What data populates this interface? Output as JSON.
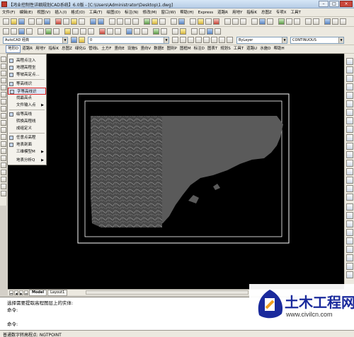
{
  "window": {
    "title": "【鸿业控制性详细规划CAD系统】6.0版 - [C:\\Users\\Administrator\\Desktop\\1.dwg]",
    "minimize_symbol": "–",
    "maximize_symbol": "□",
    "close_symbol": "×"
  },
  "menubar": {
    "items": [
      "文件(F)",
      "编辑(E)",
      "视图(V)",
      "插入(I)",
      "格式(O)",
      "工具(T)",
      "绘图(D)",
      "标注(N)",
      "修改(M)",
      "窗口(W)",
      "帮助(H)",
      "Express",
      "道路R",
      "用地Y",
      "指标K",
      "总图Z",
      "专项X",
      "工具T"
    ]
  },
  "toolbar3": {
    "workspace_combo": "AutoCAD 经典",
    "layer_combo": "0",
    "color_combo": "ByLayer",
    "linetype_combo": "CONTINUOUS"
  },
  "tabmenubar": {
    "items": [
      "地形D",
      "道路R",
      "用地Y",
      "指标K",
      "总图Z",
      "绿化G",
      "管线L",
      "土方F",
      "竖向E",
      "设施S",
      "竖向V",
      "数据E",
      "图则P",
      "图框M",
      "标注D",
      "图表T",
      "规划S",
      "工具T",
      "道路U",
      "水施D",
      "帮助H"
    ],
    "active_index": 0
  },
  "dropdown": {
    "items": [
      {
        "label": "高程点注入",
        "has_sub": false
      },
      {
        "label": "地理高程坐",
        "has_sub": false
      },
      {
        "label": "等坡高定点...",
        "has_sub": false
      },
      {
        "label": "等高线识",
        "has_sub": false
      },
      {
        "label": "字等高线识",
        "has_sub": false
      },
      {
        "label": "找最高点",
        "has_sub": false
      },
      {
        "label": "文件输入点",
        "has_sub": true
      },
      {
        "label": "绘等高线",
        "has_sub": false
      },
      {
        "label": "转换高程线",
        "has_sub": false
      },
      {
        "label": "成组定义",
        "has_sub": false
      },
      {
        "label": "任意点高程",
        "has_sub": false
      },
      {
        "label": "地表剖面",
        "has_sub": false
      },
      {
        "label": "三维模型M",
        "has_sub": true
      },
      {
        "label": "地表分析Q",
        "has_sub": true
      }
    ],
    "highlight_index": 4
  },
  "layout_tabs": {
    "nav_arrows": [
      "⏮",
      "◀",
      "▶",
      "⏭"
    ],
    "tabs": [
      "Model",
      "Layout1"
    ],
    "active_index": 0
  },
  "command": {
    "lines": [
      "选择需要提取高程图层上的实体:",
      "命令:",
      "",
      "命令:"
    ]
  },
  "statusbar": {
    "text": "普通数字转高程点: NGTPOINT"
  },
  "watermark": {
    "title": "土木工程网",
    "url": "www.civilcn.com"
  },
  "colors": {
    "canvas_background": "#000000",
    "terrain_fill": "#5a5a5a",
    "frame_stroke": "#ffffff",
    "highlight_border": "#dd2222",
    "watermark_blue": "#1a2a9c"
  }
}
